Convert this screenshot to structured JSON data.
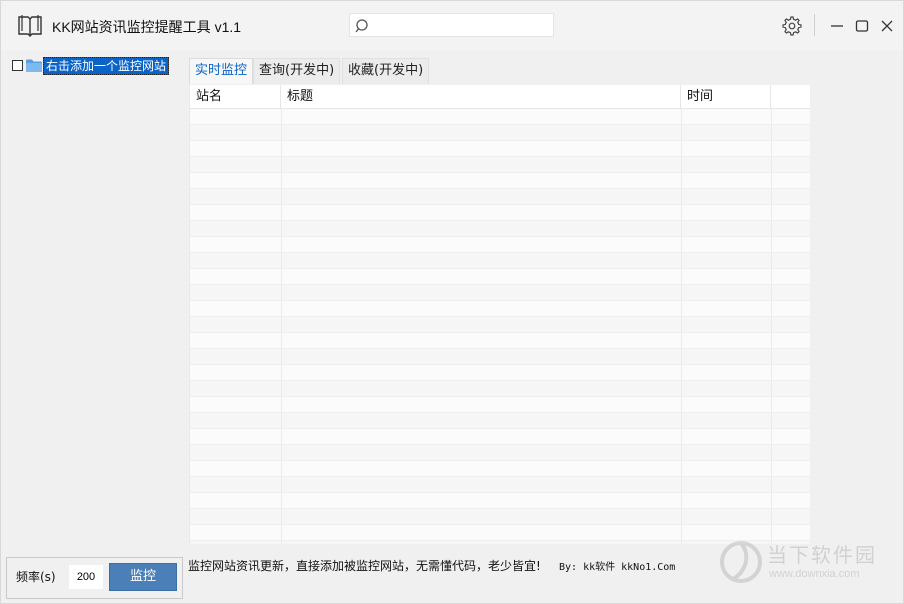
{
  "window": {
    "title": "KK网站资讯监控提醒工具 v1.1",
    "search_placeholder": ""
  },
  "tree": {
    "items": [
      {
        "label": "右击添加一个监控网站",
        "checked": false,
        "selected": true
      }
    ]
  },
  "tabs": [
    {
      "label": "实时监控",
      "active": true
    },
    {
      "label": "查询(开发中)",
      "active": false
    },
    {
      "label": "收藏(开发中)",
      "active": false
    }
  ],
  "grid": {
    "columns": [
      "站名",
      "标题",
      "时间",
      ""
    ],
    "rows": []
  },
  "controls": {
    "frequency_label": "频率(s)",
    "frequency_value": "200",
    "monitor_button": "监控"
  },
  "status": {
    "message": "监控网站资讯更新，直接添加被监控网站，无需懂代码，老少皆宜!",
    "credit": "By: kk软件 kkNo1.Com"
  },
  "watermark": {
    "name": "当下软件园",
    "url": "www.downxia.com"
  },
  "colors": {
    "accent": "#0a64c8",
    "button": "#4a7fb8",
    "background": "#f0f0f0"
  }
}
